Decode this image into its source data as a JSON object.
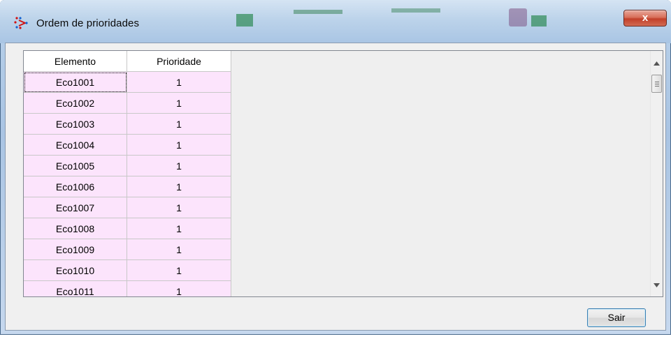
{
  "window": {
    "title": "Ordem de prioridades",
    "close_label": "x"
  },
  "grid": {
    "columns": [
      "Elemento",
      "Prioridade"
    ],
    "rows": [
      {
        "elemento": "Eco1001",
        "prioridade": "1"
      },
      {
        "elemento": "Eco1002",
        "prioridade": "1"
      },
      {
        "elemento": "Eco1003",
        "prioridade": "1"
      },
      {
        "elemento": "Eco1004",
        "prioridade": "1"
      },
      {
        "elemento": "Eco1005",
        "prioridade": "1"
      },
      {
        "elemento": "Eco1006",
        "prioridade": "1"
      },
      {
        "elemento": "Eco1007",
        "prioridade": "1"
      },
      {
        "elemento": "Eco1008",
        "prioridade": "1"
      },
      {
        "elemento": "Eco1009",
        "prioridade": "1"
      },
      {
        "elemento": "Eco1010",
        "prioridade": "1"
      },
      {
        "elemento": "Eco1011",
        "prioridade": "1"
      }
    ],
    "scroll_up_icon": "triangle-up",
    "scroll_down_icon": "triangle-down"
  },
  "footer": {
    "exit_label": "Sair"
  },
  "colors": {
    "cell_background": "#fce4fc",
    "close_button": "#c2402a",
    "button_border": "#3c7fb1"
  }
}
